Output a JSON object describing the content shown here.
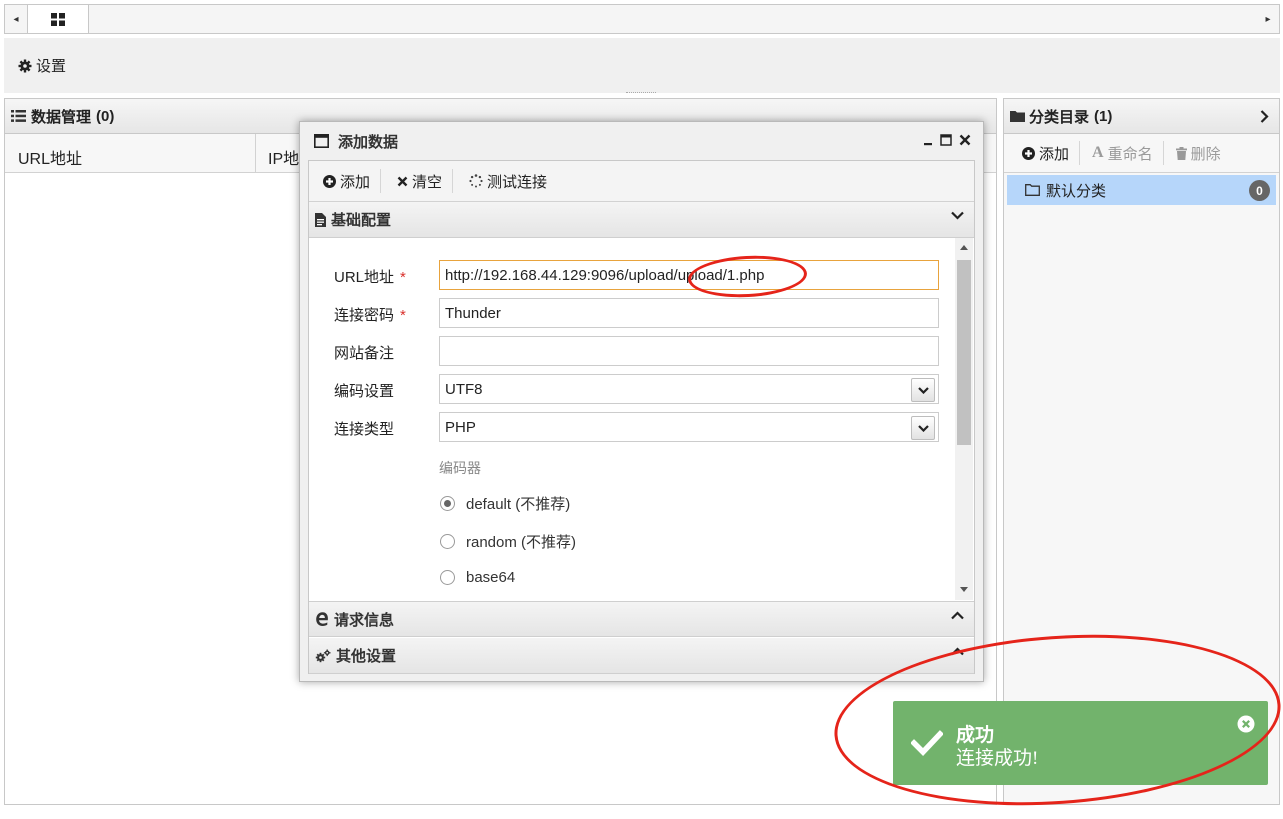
{
  "tabbar": {
    "left_arrow": "◂",
    "right_arrow": "▸",
    "home_tab_icon": "grid-icon"
  },
  "toolbar": {
    "settings_label": "设置",
    "settings_icon": "gear-icon"
  },
  "data_panel": {
    "title": "数据管理",
    "count": "(0)",
    "columns": [
      "URL地址",
      "IP地"
    ]
  },
  "category_panel": {
    "title": "分类目录",
    "count": "(1)",
    "add_label": "添加",
    "rename_label": "重命名",
    "delete_label": "删除",
    "items": [
      {
        "label": "默认分类",
        "count": "0"
      }
    ]
  },
  "dialog": {
    "title": "添加数据",
    "toolbar": {
      "add_label": "添加",
      "clear_label": "清空",
      "test_label": "测试连接"
    },
    "sections": {
      "basic": "基础配置",
      "request": "请求信息",
      "other": "其他设置"
    },
    "form": {
      "url_label": "URL地址",
      "url_value": "http://192.168.44.129:9096/upload/upload/1.php",
      "password_label": "连接密码",
      "password_value": "Thunder",
      "note_label": "网站备注",
      "note_value": "",
      "encoding_label": "编码设置",
      "encoding_value": "UTF8",
      "type_label": "连接类型",
      "type_value": "PHP",
      "encoder_label": "编码器",
      "encoders": [
        "default (不推荐)",
        "random (不推荐)",
        "base64"
      ],
      "selected_encoder": "default (不推荐)",
      "required_mark": "*"
    }
  },
  "toast": {
    "title": "成功",
    "message": "连接成功!"
  },
  "colors": {
    "toast_bg": "#72b36c",
    "annotation": "#e5241a",
    "selected_row": "#b6d6fa",
    "focus_border": "#e8a33d"
  }
}
